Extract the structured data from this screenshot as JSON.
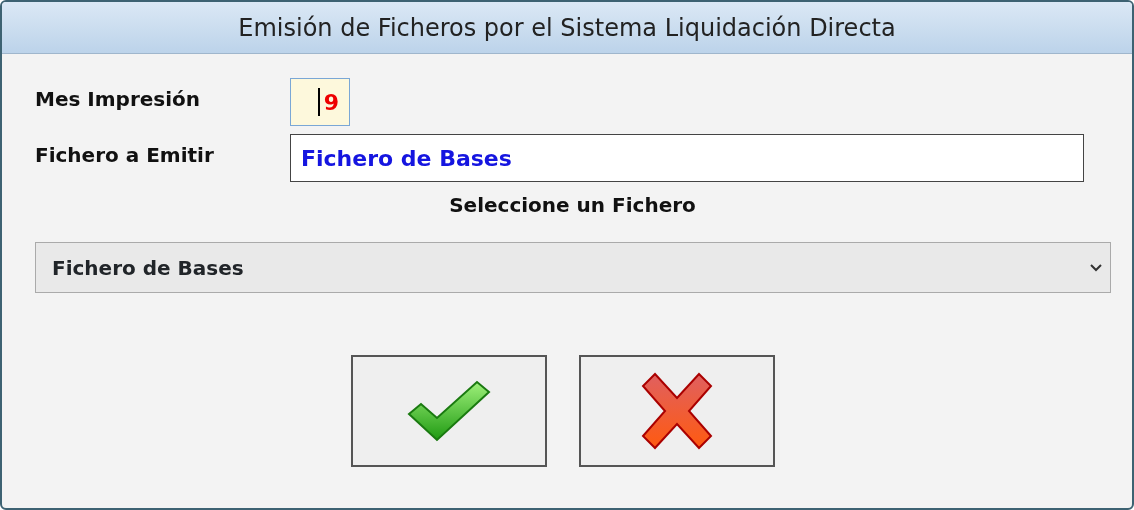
{
  "window": {
    "title": "Emisión de Ficheros por el Sistema Liquidación Directa"
  },
  "fields": [
    {
      "kind": "short",
      "label": "Mes Impresión",
      "value": "9"
    },
    {
      "kind": "wide",
      "label": "Fichero a Emitir",
      "value": "Fichero de Bases"
    }
  ],
  "selector": {
    "heading": "Seleccione un Fichero",
    "value": "Fichero de Bases"
  },
  "buttons": [
    {
      "kind": "accept"
    },
    {
      "kind": "cancel"
    }
  ]
}
